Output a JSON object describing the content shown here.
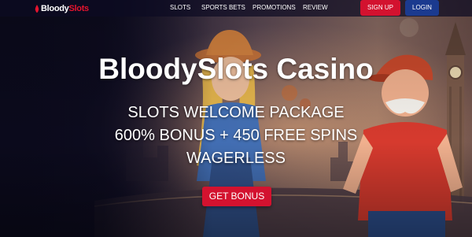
{
  "header": {
    "logo": {
      "brand_part_1": "Bloody",
      "brand_part_2": "Slots"
    },
    "nav": [
      {
        "label": "SLOTS"
      },
      {
        "label": "SPORTS BETS"
      },
      {
        "label": "PROMOTIONS"
      },
      {
        "label": "REVIEW"
      }
    ],
    "signup_label": "SIGN UP",
    "login_label": "LOGIN"
  },
  "hero": {
    "title": "BloodySlots Casino",
    "lines": [
      "SLOTS WELCOME PACKAGE",
      "600% BONUS + 450 FREE SPINS",
      "WAGERLESS"
    ],
    "cta_label": "GET BONUS"
  },
  "colors": {
    "brand_red": "#d3122f",
    "login_blue": "#1b3a8f",
    "background": "#0d0b1e"
  },
  "icons": {
    "logo": "bloodyslots-logo-icon"
  }
}
